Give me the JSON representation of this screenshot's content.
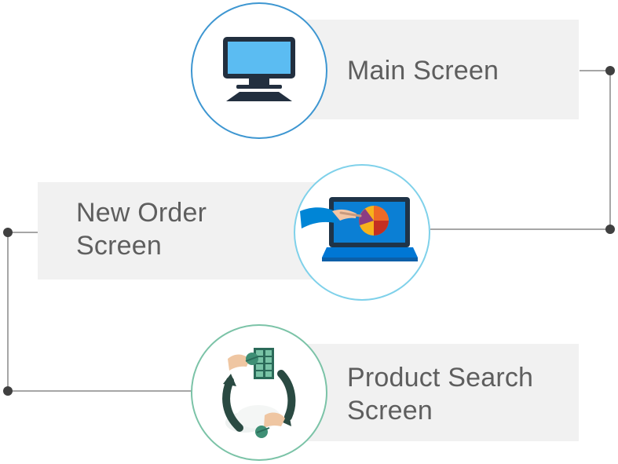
{
  "diagram": {
    "nodes": [
      {
        "id": "main",
        "label": "Main  Screen",
        "icon": "desktop-computer-icon"
      },
      {
        "id": "new-order",
        "label": "New Order\nScreen",
        "icon": "laptop-pie-chart-icon"
      },
      {
        "id": "product-search",
        "label": "Product Search\nScreen",
        "icon": "exchange-cycle-icon"
      }
    ],
    "colors": {
      "panel": "#f1f1f1",
      "text": "#5e5e5e",
      "connector": "#a6a6a6",
      "connector_dot": "#404040",
      "main_ring": "#3d96d1",
      "order_ring": "#7fd1ea",
      "product_ring": "#7bc3a7"
    }
  }
}
